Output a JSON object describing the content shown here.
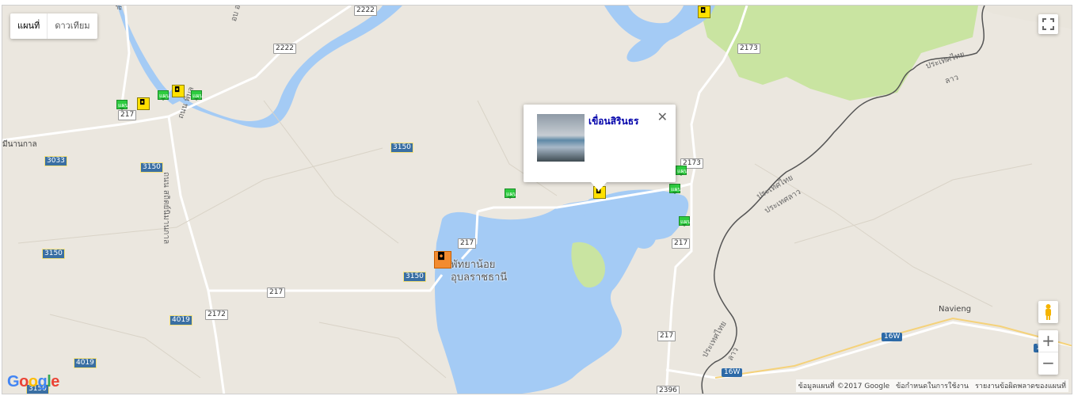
{
  "map_type": {
    "map": "แผนที่",
    "satellite": "ดาวเทียม"
  },
  "labels": {
    "place_main_line1": "พัทยาน้อย",
    "place_main_line2": "อุบลราชธานี",
    "navieng": "Navieng",
    "thai_border1": "ประเทศไทย",
    "laos1": "ลาว",
    "thai_border2": "ประเทศไทย",
    "laos2": "ประเทศลาว",
    "thai_border3": "ประเทศไทย",
    "laos3": "ลาว",
    "left_edge": "มีนานกาล",
    "road_name1": "ถนน สถิตย์นิมานกาล",
    "road_name2": "ถนน พิบูล",
    "river1": "ลำโดม",
    "river2": "อบ อ"
  },
  "shields": {
    "r2222a": "2222",
    "r2222b": "2222",
    "r217a": "217",
    "r217b": "217",
    "r217c": "217",
    "r217d": "217",
    "r217e": "217",
    "r2173a": "2173",
    "r2173b": "2173",
    "r2172": "2172",
    "r2396": "2396",
    "r3150a": "3150",
    "r3150b": "3150",
    "r3150c": "3150",
    "r3150d": "3150",
    "r3033": "3033",
    "r4019a": "4019",
    "r4019b": "4019",
    "r3150e": "3150",
    "w16a": "16W",
    "w16b": "16W",
    "w16c": "16"
  },
  "infowindow": {
    "title": "เขื่อนสิรินธร",
    "close": "✕"
  },
  "controls": {
    "zoom_in": "+",
    "zoom_out": "−"
  },
  "attribution": {
    "data": "ข้อมูลแผนที่ ©2017 Google",
    "terms": "ข้อกำหนดในการใช้งาน",
    "report": "รายงานข้อผิดพลาดของแผนที่"
  },
  "logo": [
    "G",
    "o",
    "o",
    "g",
    "l",
    "e"
  ],
  "colors": {
    "land": "#ebe7df",
    "water": "#a4cbf5",
    "park": "#c9e4a1",
    "road": "#ffffff",
    "border": "#555555"
  },
  "marker_glyphs": {
    "camera": "◘",
    "green": "แผน"
  }
}
